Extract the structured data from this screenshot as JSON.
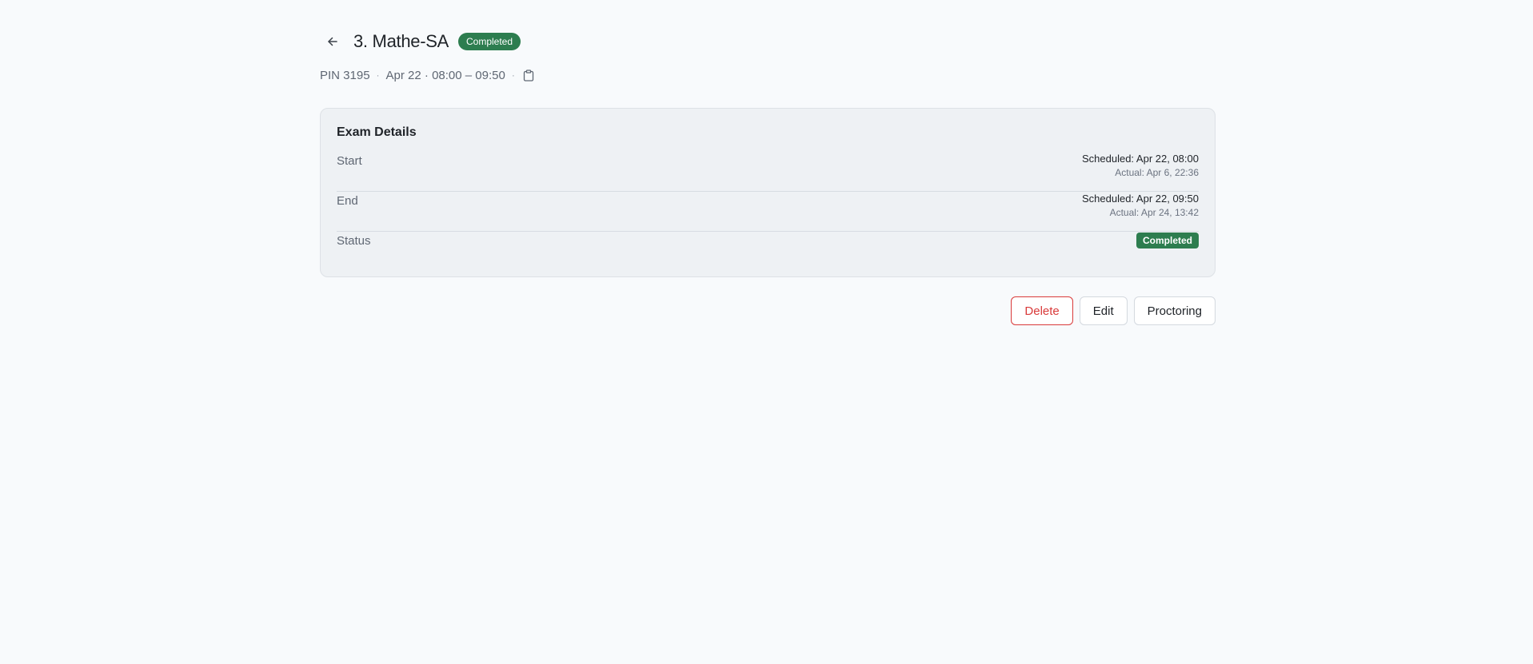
{
  "header": {
    "title": "3. Mathe-SA",
    "status_badge": "Completed"
  },
  "subline": {
    "pin": "PIN 3195",
    "separator": "·",
    "schedule": "Apr 22 · 08:00 – 09:50"
  },
  "details": {
    "title": "Exam Details",
    "rows": [
      {
        "label": "Start",
        "scheduled": "Scheduled: Apr 22, 08:00",
        "actual": "Actual: Apr 6, 22:36"
      },
      {
        "label": "End",
        "scheduled": "Scheduled: Apr 22, 09:50",
        "actual": "Actual: Apr 24, 13:42"
      },
      {
        "label": "Status",
        "badge": "Completed"
      }
    ]
  },
  "actions": {
    "delete_label": "Delete",
    "edit_label": "Edit",
    "proctoring_label": "Proctoring"
  },
  "icons": {
    "back": "arrow-left-icon",
    "copy": "clipboard-icon"
  },
  "colors": {
    "success": "#2d7d4f",
    "danger": "#d93a3a",
    "background": "#f8fafc",
    "card": "#eef1f4"
  }
}
